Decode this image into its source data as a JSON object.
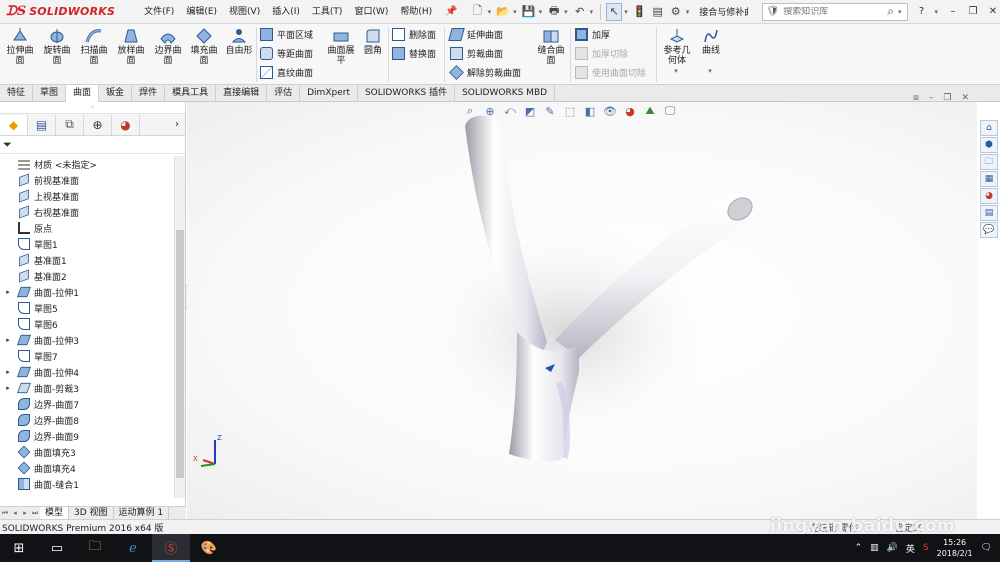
{
  "app": {
    "name": "SOLIDWORKS",
    "doc_title": "接合与修补曲..."
  },
  "menu": [
    "文件(F)",
    "编辑(E)",
    "视图(V)",
    "插入(I)",
    "工具(T)",
    "窗口(W)",
    "帮助(H)"
  ],
  "search": {
    "placeholder": "搜索知识库"
  },
  "ribbon": {
    "big_buttons": [
      {
        "label1": "拉伸曲",
        "label2": "面"
      },
      {
        "label1": "旋转曲",
        "label2": "面"
      },
      {
        "label1": "扫描曲",
        "label2": "面"
      },
      {
        "label1": "放样曲",
        "label2": "面"
      },
      {
        "label1": "边界曲",
        "label2": "面"
      },
      {
        "label1": "填充曲",
        "label2": "面"
      },
      {
        "label1": "自由形",
        "label2": ""
      }
    ],
    "col1": [
      "平面区域",
      "等距曲面",
      "直纹曲面"
    ],
    "mid_big": [
      {
        "label1": "曲面展",
        "label2": "平"
      },
      {
        "label1": "圆角",
        "label2": ""
      }
    ],
    "col2": [
      "删除面",
      "替换面"
    ],
    "col3": [
      "延伸曲面",
      "剪裁曲面",
      "解除剪裁曲面"
    ],
    "knit": {
      "label1": "缝合曲",
      "label2": "面"
    },
    "col4": [
      "加厚",
      "加厚切除",
      "使用曲面切除"
    ],
    "ref": {
      "label1": "参考几",
      "label2": "何体"
    },
    "curve": {
      "label1": "曲线",
      "label2": ""
    }
  },
  "command_tabs": [
    "特征",
    "草图",
    "曲面",
    "钣金",
    "焊件",
    "模具工具",
    "直接编辑",
    "评估",
    "DimXpert",
    "SOLIDWORKS 插件",
    "SOLIDWORKS MBD"
  ],
  "active_command_tab": "曲面",
  "tree": [
    {
      "label": "材质 <未指定>",
      "icon": "material-icon",
      "exp": false
    },
    {
      "label": "前视基准面",
      "icon": "plane-icon",
      "exp": false
    },
    {
      "label": "上视基准面",
      "icon": "plane-icon",
      "exp": false
    },
    {
      "label": "右视基准面",
      "icon": "plane-icon",
      "exp": false
    },
    {
      "label": "原点",
      "icon": "origin-icon",
      "exp": false
    },
    {
      "label": "草图1",
      "icon": "sketch-icon",
      "exp": false
    },
    {
      "label": "基准面1",
      "icon": "plane-icon",
      "exp": false
    },
    {
      "label": "基准面2",
      "icon": "plane-icon",
      "exp": false
    },
    {
      "label": "曲面-拉伸1",
      "icon": "surface-extrude-icon",
      "exp": true
    },
    {
      "label": "草图5",
      "icon": "sketch-icon",
      "exp": false
    },
    {
      "label": "草图6",
      "icon": "sketch-icon",
      "exp": false
    },
    {
      "label": "曲面-拉伸3",
      "icon": "surface-extrude-icon",
      "exp": true
    },
    {
      "label": "草图7",
      "icon": "sketch-icon",
      "exp": false
    },
    {
      "label": "曲面-拉伸4",
      "icon": "surface-extrude-icon",
      "exp": true
    },
    {
      "label": "曲面-剪裁3",
      "icon": "surface-trim-icon",
      "exp": true
    },
    {
      "label": "边界-曲面7",
      "icon": "boundary-surface-icon",
      "exp": false
    },
    {
      "label": "边界-曲面8",
      "icon": "boundary-surface-icon",
      "exp": false
    },
    {
      "label": "边界-曲面9",
      "icon": "boundary-surface-icon",
      "exp": false
    },
    {
      "label": "曲面填充3",
      "icon": "fill-surface-icon",
      "exp": false
    },
    {
      "label": "曲面填充4",
      "icon": "fill-surface-icon",
      "exp": false
    },
    {
      "label": "曲面-缝合1",
      "icon": "knit-surface-icon",
      "exp": false
    }
  ],
  "bottom_tabs": [
    "模型",
    "3D 视图",
    "运动算例 1"
  ],
  "status": {
    "left": "SOLIDWORKS Premium 2016 x64 版",
    "r1": "在编辑 零件",
    "r2": "自定义"
  },
  "watermark": "jingyan.baidu.com",
  "taskbar": {
    "time": "15:26",
    "date": "2018/2/1",
    "ime": "英"
  },
  "colors": {
    "brand": "#d3232a",
    "accent": "#2d5a93"
  }
}
